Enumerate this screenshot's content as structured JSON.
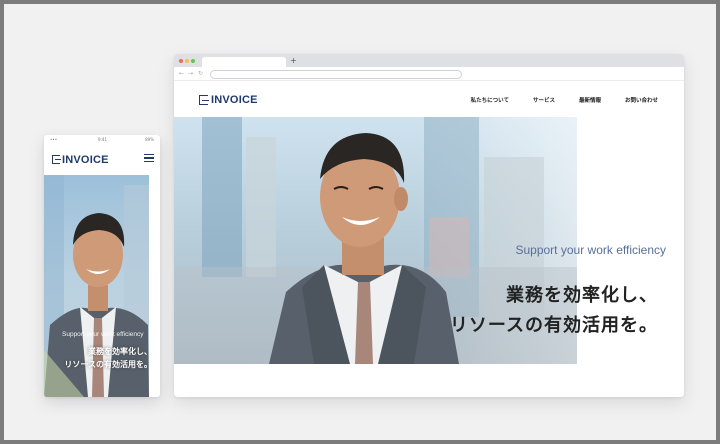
{
  "browser": {
    "new_tab_label": "+",
    "back_icon": "chevron-left-icon",
    "forward_icon": "chevron-right-icon",
    "reload_icon": "reload-icon"
  },
  "site": {
    "logo_text": "INVOICE",
    "menu": [
      {
        "label": "私たちについて"
      },
      {
        "label": "サービス"
      },
      {
        "label": "最新情報"
      },
      {
        "label": "お問い合わせ"
      }
    ],
    "tagline_en": "Support your work efficiency",
    "tagline_jp_line1": "業務を効率化し、",
    "tagline_jp_line2": "リソースの有効活用を。"
  },
  "phone": {
    "status_left": "•••",
    "status_time": "9:41",
    "status_battery": "89%",
    "logo_text": "INVOICE",
    "menu_icon": "hamburger-menu-icon",
    "tagline_en": "Support your work efficiency",
    "tagline_jp_line1": "業務を効率化し、",
    "tagline_jp_line2": "リソースの有効活用を。"
  },
  "colors": {
    "brand_navy": "#1f3a6b",
    "tagline_blue": "#5a6f97"
  }
}
